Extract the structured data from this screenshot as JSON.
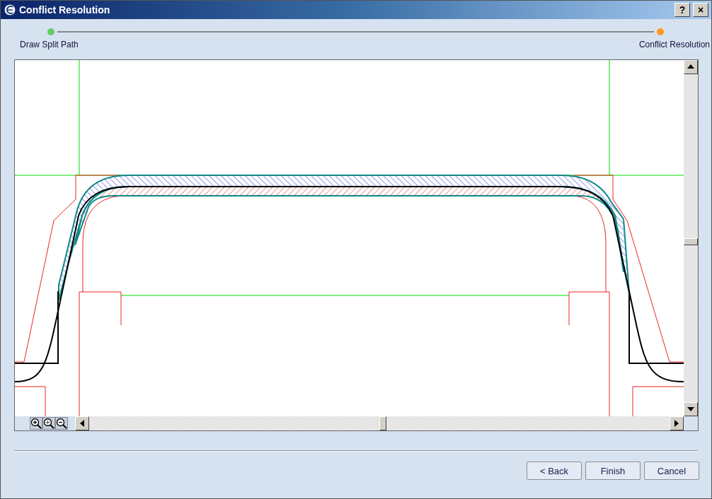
{
  "window": {
    "title": "Conflict Resolution",
    "help_button": "?",
    "close_button": "×"
  },
  "steps": [
    {
      "label": "Draw Split Path",
      "color": "#66cc66"
    },
    {
      "label": "Conflict Resolution",
      "color": "#ff9922"
    }
  ],
  "buttons": [
    {
      "label": "< Back"
    },
    {
      "label": "Finish"
    },
    {
      "label": "Cancel"
    }
  ]
}
